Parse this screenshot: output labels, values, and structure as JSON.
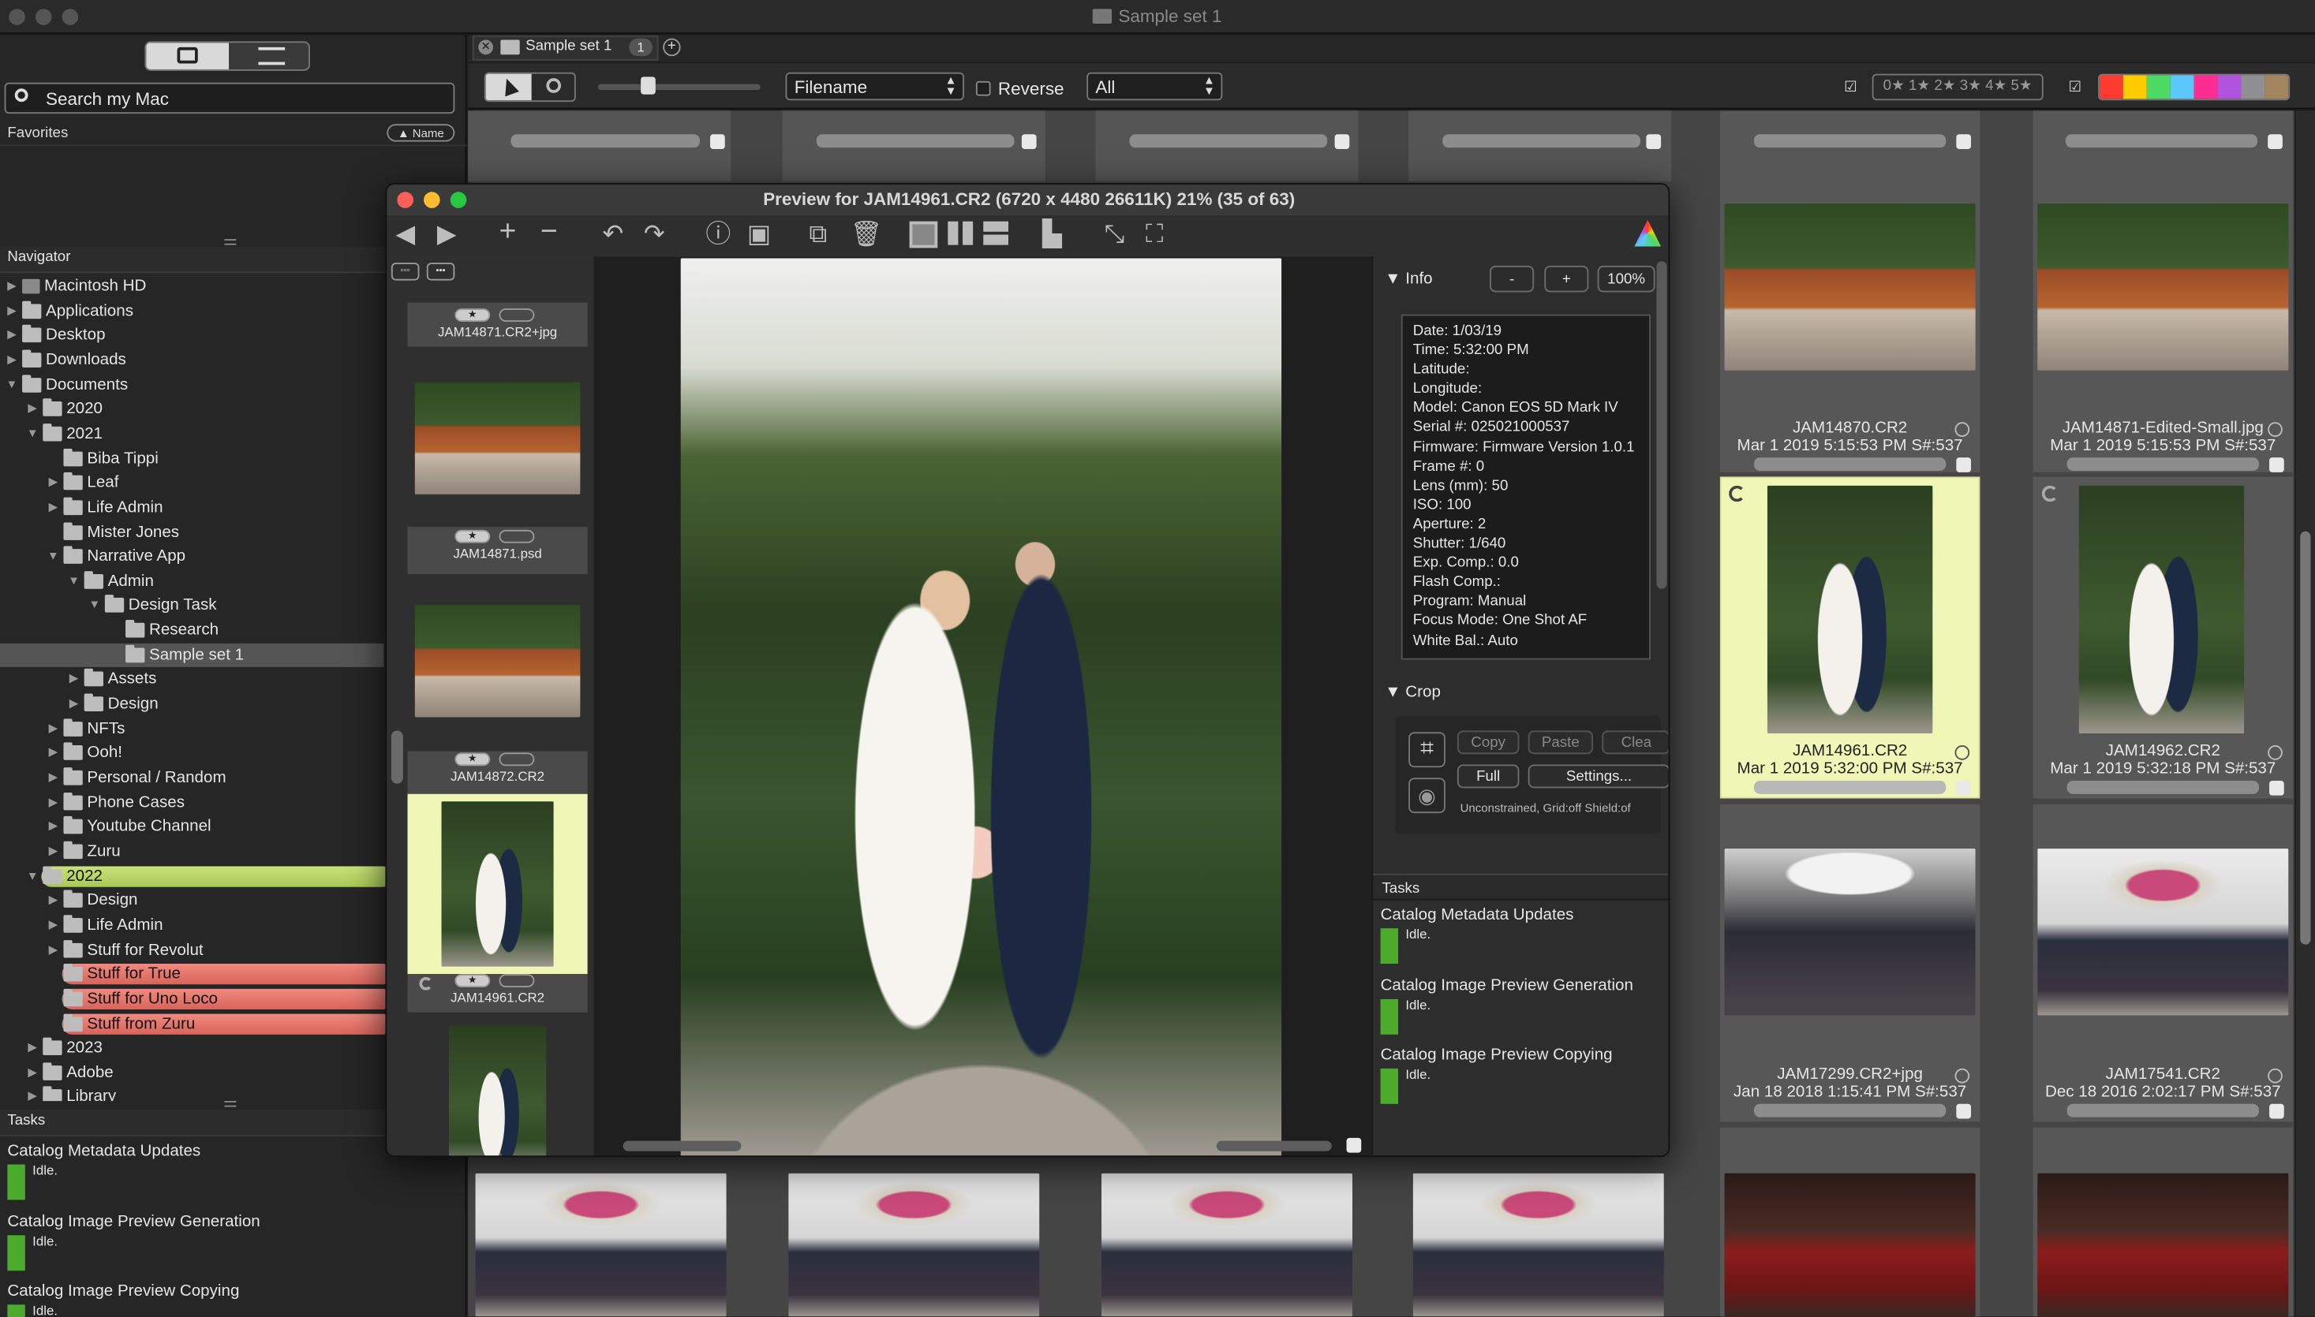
{
  "window": {
    "title": "Sample set 1"
  },
  "tabs": {
    "tab_label": "Sample set 1",
    "tab_count": "1"
  },
  "toolbar": {
    "sort_select": "Filename",
    "reverse_label": "Reverse",
    "filter_select": "All",
    "star_filter": "0★ 1★ 2★ 3★ 4★ 5★",
    "swatch_colors": [
      "#ff3b30",
      "#ffcc00",
      "#4cd964",
      "#5ac8fa",
      "#ff2d92",
      "#af52de",
      "#8e8e93",
      "#a2845e"
    ]
  },
  "sidebar": {
    "search_placeholder": "Search my Mac",
    "favorites_label": "Favorites",
    "name_sort_label": "▲ Name",
    "navigator_label": "Navigator",
    "tree": [
      {
        "label": "Macintosh HD",
        "depth": 0,
        "arrow": "▶",
        "kind": "disk"
      },
      {
        "label": "Applications",
        "depth": 0,
        "arrow": "▶",
        "kind": "folder"
      },
      {
        "label": "Desktop",
        "depth": 0,
        "arrow": "▶",
        "kind": "folder"
      },
      {
        "label": "Downloads",
        "depth": 0,
        "arrow": "▶",
        "kind": "folder"
      },
      {
        "label": "Documents",
        "depth": 0,
        "arrow": "▼",
        "kind": "folder"
      },
      {
        "label": "2020",
        "depth": 1,
        "arrow": "▶",
        "kind": "folder"
      },
      {
        "label": "2021",
        "depth": 1,
        "arrow": "▼",
        "kind": "folder"
      },
      {
        "label": "Biba Tippi",
        "depth": 2,
        "arrow": "",
        "kind": "folder"
      },
      {
        "label": "Leaf",
        "depth": 2,
        "arrow": "▶",
        "kind": "folder"
      },
      {
        "label": "Life Admin",
        "depth": 2,
        "arrow": "▶",
        "kind": "folder"
      },
      {
        "label": "Mister Jones",
        "depth": 2,
        "arrow": "",
        "kind": "folder"
      },
      {
        "label": "Narrative App",
        "depth": 2,
        "arrow": "▼",
        "kind": "folder"
      },
      {
        "label": "Admin",
        "depth": 3,
        "arrow": "▼",
        "kind": "folder"
      },
      {
        "label": "Design Task",
        "depth": 4,
        "arrow": "▼",
        "kind": "folder"
      },
      {
        "label": "Research",
        "depth": 5,
        "arrow": "",
        "kind": "folder"
      },
      {
        "label": "Sample set 1",
        "depth": 5,
        "arrow": "",
        "kind": "folder",
        "selected": true
      },
      {
        "label": "Assets",
        "depth": 3,
        "arrow": "▶",
        "kind": "folder"
      },
      {
        "label": "Design",
        "depth": 3,
        "arrow": "▶",
        "kind": "folder"
      },
      {
        "label": "NFTs",
        "depth": 2,
        "arrow": "▶",
        "kind": "folder"
      },
      {
        "label": "Ooh!",
        "depth": 2,
        "arrow": "▶",
        "kind": "folder"
      },
      {
        "label": "Personal / Random",
        "depth": 2,
        "arrow": "▶",
        "kind": "folder"
      },
      {
        "label": "Phone Cases",
        "depth": 2,
        "arrow": "▶",
        "kind": "folder"
      },
      {
        "label": "Youtube Channel",
        "depth": 2,
        "arrow": "▶",
        "kind": "folder"
      },
      {
        "label": "Zuru",
        "depth": 2,
        "arrow": "▶",
        "kind": "folder"
      },
      {
        "label": "2022",
        "depth": 1,
        "arrow": "▼",
        "kind": "folder",
        "tag": "green"
      },
      {
        "label": "Design",
        "depth": 2,
        "arrow": "▶",
        "kind": "folder"
      },
      {
        "label": "Life Admin",
        "depth": 2,
        "arrow": "▶",
        "kind": "folder"
      },
      {
        "label": "Stuff for Revolut",
        "depth": 2,
        "arrow": "▶",
        "kind": "folder"
      },
      {
        "label": "Stuff for True",
        "depth": 2,
        "arrow": "",
        "kind": "folder",
        "tag": "red"
      },
      {
        "label": "Stuff for Uno Loco",
        "depth": 2,
        "arrow": "",
        "kind": "folder",
        "tag": "red"
      },
      {
        "label": "Stuff from Zuru",
        "depth": 2,
        "arrow": "",
        "kind": "folder",
        "tag": "red"
      },
      {
        "label": "2023",
        "depth": 1,
        "arrow": "▶",
        "kind": "folder"
      },
      {
        "label": "Adobe",
        "depth": 1,
        "arrow": "▶",
        "kind": "folder"
      },
      {
        "label": "Library",
        "depth": 1,
        "arrow": "▶",
        "kind": "folder"
      }
    ],
    "tasks_label": "Tasks",
    "tasks": [
      {
        "name": "Catalog Metadata Updates",
        "status": "Idle."
      },
      {
        "name": "Catalog Image Preview Generation",
        "status": "Idle."
      },
      {
        "name": "Catalog Image Preview Copying",
        "status": "Idle."
      }
    ]
  },
  "preview": {
    "title": "Preview for JAM14961.CR2 (6720 x 4480 26611K) 21% (35 of 63)",
    "filmstrip": [
      {
        "label": "JAM14871.CR2+jpg"
      },
      {
        "label": "JAM14871.psd"
      },
      {
        "label": "JAM14872.CR2"
      },
      {
        "label": "JAM14961.CR2"
      }
    ],
    "info": {
      "label": "Info",
      "zoom_minus": "-",
      "zoom_plus": "+",
      "zoom_value": "100%",
      "lines": [
        "Date: 1/03/19",
        "Time: 5:32:00 PM",
        "Latitude:",
        "Longitude:",
        "Model: Canon EOS 5D Mark IV",
        "Serial #: 025021000537",
        "Firmware: Firmware Version 1.0.1",
        "Frame #: 0",
        "Lens (mm): 50",
        "ISO: 100",
        "Aperture: 2",
        "Shutter: 1/640",
        "Exp. Comp.: 0.0",
        "Flash Comp.:",
        "Program: Manual",
        "Focus Mode: One Shot AF",
        "White Bal.: Auto"
      ]
    },
    "crop": {
      "label": "Crop",
      "copy": "Copy",
      "paste": "Paste",
      "clear": "Clea",
      "full": "Full",
      "settings": "Settings...",
      "status": "Unconstrained, Grid:off Shield:of"
    },
    "tasks_label": "Tasks",
    "tasks": [
      {
        "name": "Catalog Metadata Updates",
        "status": "Idle."
      },
      {
        "name": "Catalog Image Preview Generation",
        "status": "Idle."
      },
      {
        "name": "Catalog Image Preview Copying",
        "status": "Idle."
      }
    ]
  },
  "grid": {
    "cells": [
      {
        "name": "JAM14870.CR2",
        "date": "Mar 1 2019 5:15:53 PM S#:537"
      },
      {
        "name": "JAM14871-Edited-Small.jpg",
        "date": "Mar 1 2019 5:15:53 PM S#:537"
      },
      {
        "name": "JAM14961.CR2",
        "date": "Mar 1 2019 5:32:00 PM S#:537"
      },
      {
        "name": "JAM14962.CR2",
        "date": "Mar 1 2019 5:32:18 PM S#:537"
      },
      {
        "name": "JAM17299.CR2+jpg",
        "date": "Jan 18 2018 1:15:41 PM S#:537"
      },
      {
        "name": "JAM17541.CR2",
        "date": "Dec 18 2016 2:02:17 PM S#:537"
      }
    ]
  }
}
